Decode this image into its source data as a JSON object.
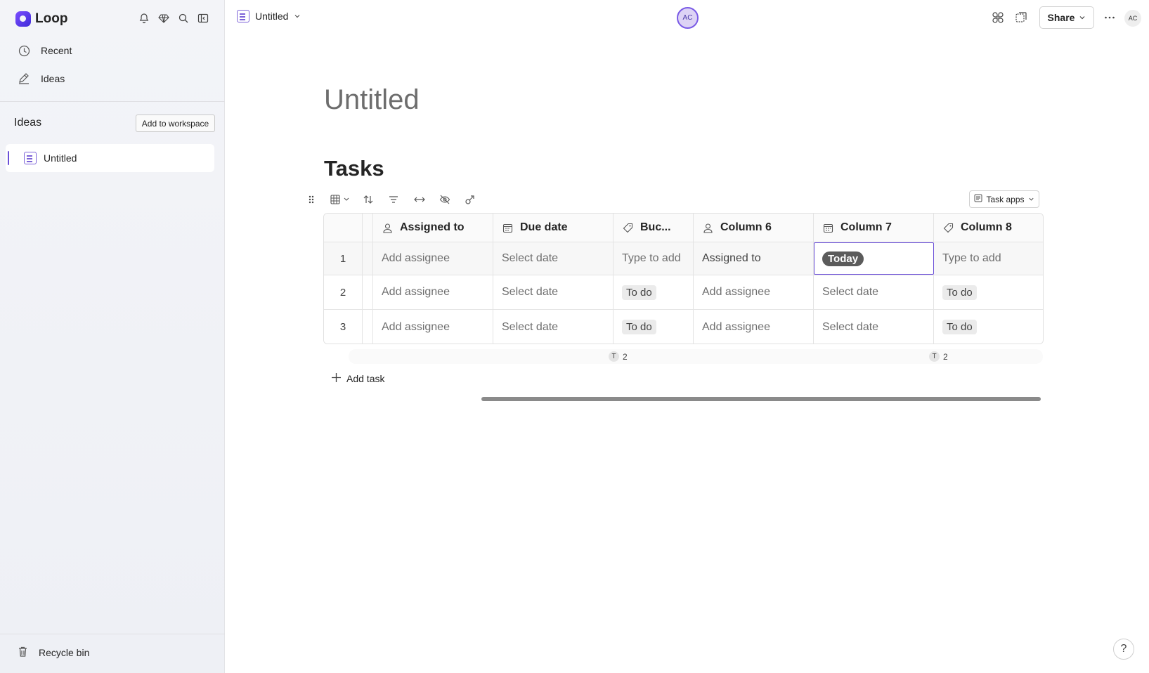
{
  "app": {
    "name": "Loop"
  },
  "sidebar": {
    "nav": [
      {
        "label": "Recent",
        "icon": "clock-icon"
      },
      {
        "label": "Ideas",
        "icon": "pen-icon"
      }
    ],
    "section_title": "Ideas",
    "add_workspace_label": "Add to workspace",
    "pages": [
      {
        "label": "Untitled",
        "icon": "loop-page-icon"
      }
    ],
    "recycle_label": "Recycle bin"
  },
  "topbar": {
    "doc_title": "Untitled",
    "presence_initials": "AC",
    "share_label": "Share",
    "user_initials": "AC"
  },
  "page": {
    "title": "Untitled",
    "heading": "Tasks",
    "task_apps_label": "Task apps"
  },
  "table": {
    "columns": [
      {
        "label": "Assigned to",
        "icon": "person-icon"
      },
      {
        "label": "Due date",
        "icon": "calendar-icon"
      },
      {
        "label": "Buc...",
        "icon": "tag-icon"
      },
      {
        "label": "Column 6",
        "icon": "person-icon"
      },
      {
        "label": "Column 7",
        "icon": "calendar-icon"
      },
      {
        "label": "Column 8",
        "icon": "tag-icon"
      }
    ],
    "rows": [
      {
        "num": "1",
        "cells": [
          "Add assignee",
          "Select date",
          "Type to add",
          "Assigned to",
          "Today",
          "Type to add"
        ]
      },
      {
        "num": "2",
        "cells": [
          "Add assignee",
          "Select date",
          "To do",
          "Add assignee",
          "Select date",
          "To do"
        ]
      },
      {
        "num": "3",
        "cells": [
          "Add assignee",
          "Select date",
          "To do",
          "Add assignee",
          "Select date",
          "To do"
        ]
      }
    ],
    "summaries": [
      {
        "badge": "T",
        "count": "2"
      },
      {
        "badge": "T",
        "count": "2"
      }
    ],
    "add_task_label": "Add task"
  },
  "help_label": "?",
  "colors": {
    "accent": "#6b4fd8",
    "today_pill": "#5b5b5b"
  }
}
